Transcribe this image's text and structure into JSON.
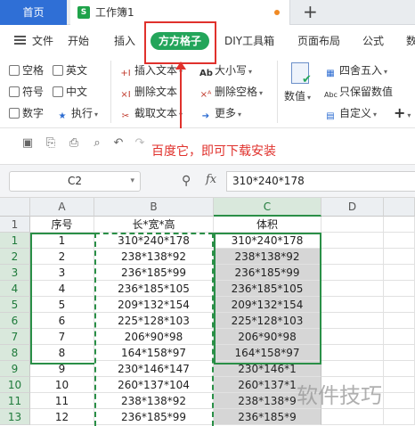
{
  "tabs": {
    "home": "首页",
    "workbook": "工作簿1",
    "wps_icon_letter": "S"
  },
  "menu": {
    "file": "文件",
    "items": [
      "开始",
      "插入",
      "方方格子",
      "DIY工具箱",
      "页面布局",
      "公式",
      "数"
    ]
  },
  "ribbon": {
    "checks": [
      "空格",
      "英文",
      "符号",
      "中文",
      "数字"
    ],
    "execute": "执行",
    "insert_text": "插入文本",
    "delete_text": "删除文本",
    "cut_text": "截取文本",
    "case": "大小写",
    "delete_space": "删除空格",
    "more": "更多",
    "numeric": "数值",
    "round": "四舍五入",
    "keep_numeric": "只保留数值",
    "custom": "自定义"
  },
  "annotation": "百度它，即可下载安装",
  "formula_bar": {
    "cell_ref": "C2",
    "fx": "fx",
    "formula": "310*240*178"
  },
  "grid": {
    "columns": [
      "A",
      "B",
      "C",
      "D"
    ],
    "headers": [
      "序号",
      "长*宽*高",
      "体积"
    ],
    "rows": [
      {
        "n": "1",
        "a": "1",
        "b": "310*240*178",
        "c": "310*240*178"
      },
      {
        "n": "2",
        "a": "2",
        "b": "238*138*92",
        "c": "238*138*92"
      },
      {
        "n": "3",
        "a": "3",
        "b": "236*185*99",
        "c": "236*185*99"
      },
      {
        "n": "4",
        "a": "4",
        "b": "236*185*105",
        "c": "236*185*105"
      },
      {
        "n": "5",
        "a": "5",
        "b": "209*132*154",
        "c": "209*132*154"
      },
      {
        "n": "6",
        "a": "6",
        "b": "225*128*103",
        "c": "225*128*103"
      },
      {
        "n": "7",
        "a": "7",
        "b": "206*90*98",
        "c": "206*90*98"
      },
      {
        "n": "8",
        "a": "8",
        "b": "164*158*97",
        "c": "164*158*97"
      },
      {
        "n": "9",
        "a": "9",
        "b": "230*146*147",
        "c": "230*146*1"
      },
      {
        "n": "10",
        "a": "10",
        "b": "260*137*104",
        "c": "260*137*1"
      },
      {
        "n": "11",
        "a": "11",
        "b": "238*138*92",
        "c": "238*138*9"
      },
      {
        "n": "12",
        "a": "12",
        "b": "236*185*99",
        "c": "236*185*9"
      }
    ],
    "header_row_num": "1",
    "last_row_num": "13"
  },
  "watermark": "软件技巧",
  "colors": {
    "accent_blue": "#2f6fd6",
    "accent_green": "#23a55a",
    "highlight_red": "#e0312c"
  }
}
